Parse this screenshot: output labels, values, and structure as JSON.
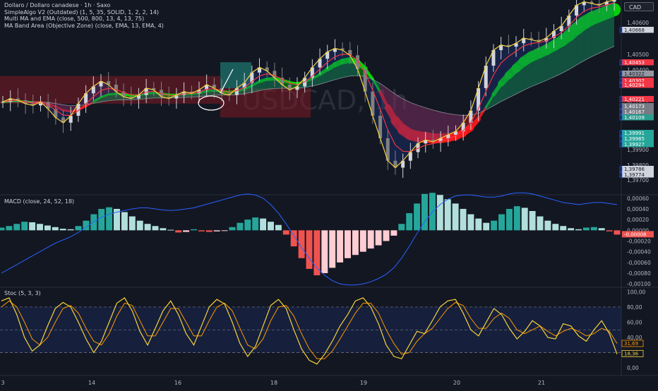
{
  "header": {
    "line1": "Dollaro / Dollaro canadese · 1h · Saxo",
    "line2": "SimpleAlgo V2 (Outdated) (1, 5, 35, SOLID, 1, 2, 2, 14)",
    "line3": "Multi MA and EMA (close, 500, 800, 13, 4, 13, 75)",
    "line4": "MA Band Area (Objective Zone) (close, EMA, 13, EMA, 4)",
    "currency": "CAD",
    "watermark": "USDCAD, 1h"
  },
  "colors": {
    "background": "#131722",
    "up": "#d1d4dc",
    "down": "#808080",
    "price_line": "#f7d23d",
    "ema_fast": "#f23645",
    "ma_slow": "#b2b5be",
    "band_green": "#00e600",
    "band_red": "#ff1a1a",
    "macd_pos_strong": "#26a69a",
    "macd_pos_weak": "#b2dfdb",
    "macd_neg_strong": "#ef5350",
    "macd_neg_weak": "#ffcdd2",
    "macd_line": "#2962ff",
    "stoch_k": "#f7d23d",
    "stoch_d": "#ff9800"
  },
  "price_axis": {
    "ticks": [
      "1,40600",
      "1,40500",
      "1,40400",
      "1,40200",
      "1,40000",
      "1,39900",
      "1,39800",
      "1,39700"
    ],
    "labels": [
      {
        "text": "1,40668",
        "bg": "#d1d4dc",
        "fg": "#131722"
      },
      {
        "text": "1,40453",
        "bg": "#f23645",
        "fg": "#ffffff"
      },
      {
        "text": "1,40322",
        "bg": "#9598a1",
        "fg": "#131722"
      },
      {
        "text": "1,40302",
        "bg": "#f23645",
        "fg": "#ffffff"
      },
      {
        "text": "1,40294",
        "bg": "#f23645",
        "fg": "#ffffff"
      },
      {
        "text": "1,40221",
        "bg": "#f23645",
        "fg": "#ffffff"
      },
      {
        "text": "1,40173",
        "bg": "#787b86",
        "fg": "#ffffff"
      },
      {
        "text": "1,40167",
        "bg": "#787b86",
        "fg": "#ffffff"
      },
      {
        "text": "1,40109",
        "bg": "#2a9d8f",
        "fg": "#ffffff"
      },
      {
        "text": "1,39991",
        "bg": "#26a69a",
        "fg": "#ffffff"
      },
      {
        "text": "1,39985",
        "bg": "#26a69a",
        "fg": "#ffffff"
      },
      {
        "text": "1,39927",
        "bg": "#26a69a",
        "fg": "#ffffff"
      },
      {
        "text": "1,39786",
        "bg": "#d1d4dc",
        "fg": "#131722"
      },
      {
        "text": "1,39774",
        "bg": "#d1d4dc",
        "fg": "#131722"
      }
    ]
  },
  "x_axis": {
    "labels": [
      "3",
      "14",
      "16",
      "18",
      "19",
      "20",
      "21"
    ]
  },
  "macd": {
    "title": "MACD (close, 24, 52, 18)",
    "ticks": [
      "0,00060",
      "0,00040",
      "0,00020",
      "0,00000",
      "-0,00020",
      "-0,00040",
      "-0,00060",
      "-0,00080",
      "-0,00100"
    ],
    "last_label": "-0,00008"
  },
  "stoch": {
    "title": "Stoc (5, 3, 3)",
    "ticks": [
      "100,00",
      "80,00",
      "60,00",
      "40,00",
      "20,00",
      "0,00"
    ],
    "last_d": "31,69",
    "last_k": "18,36"
  },
  "chart_data": [
    {
      "type": "line",
      "title": "Dollaro / Dollaro canadese · 1h · Saxo",
      "ylabel": "",
      "xlabel": "",
      "ylim": [
        1.3968,
        1.4075
      ],
      "x_tick_labels": [
        "3",
        "14",
        "16",
        "18",
        "19",
        "20",
        "21"
      ],
      "y_tick_labels": [
        "1,40600",
        "1,40500",
        "1,40400",
        "1,40200",
        "1,40000",
        "1,39900",
        "1,39800",
        "1,39700"
      ],
      "series": [
        {
          "values": [
            1.4016,
            1.4018,
            1.4017,
            1.4015,
            1.4014,
            1.4016,
            1.4012,
            1.4007,
            1.4004,
            1.4008,
            1.4015,
            1.4021,
            1.4025,
            1.4028,
            1.4026,
            1.4022,
            1.4019,
            1.4018,
            1.402,
            1.4024,
            1.4023,
            1.4019,
            1.4018,
            1.402,
            1.4022,
            1.4021,
            1.4023,
            1.4026,
            1.4024,
            1.4021,
            1.402,
            1.4024,
            1.4027,
            1.4033,
            1.4036,
            1.4034,
            1.403,
            1.4026,
            1.4023,
            1.4025,
            1.403,
            1.4036,
            1.4041,
            1.4045,
            1.4047,
            1.4046,
            1.4043,
            1.4035,
            1.4022,
            1.4008,
            1.3995,
            1.3982,
            1.3978,
            1.3982,
            1.3987,
            1.3992,
            1.3994,
            1.3993,
            1.3995,
            1.3997,
            1.3999,
            1.4004,
            1.4011,
            1.4024,
            1.4037,
            1.4046,
            1.4049,
            1.4048,
            1.405,
            1.4053,
            1.4052,
            1.4051,
            1.4053,
            1.4057,
            1.406,
            1.4066,
            1.4072,
            1.4074,
            1.4073,
            1.4072,
            1.4074,
            1.4075
          ]
        }
      ]
    },
    {
      "type": "bar",
      "title": "MACD (close, 24, 52, 18)",
      "ylim": [
        -0.00105,
        0.00065
      ],
      "series": [
        {
          "values": [
            5e-05,
            8e-05,
            0.00012,
            0.00016,
            0.00015,
            0.00012,
            9e-05,
            6e-05,
            3e-05,
            2e-05,
            8e-05,
            0.00018,
            0.0003,
            0.0004,
            0.00043,
            0.0004,
            0.00034,
            0.00026,
            0.00018,
            0.00012,
            8e-05,
            4e-05,
            1e-05,
            -4e-05,
            -3e-05,
            2e-05,
            -2e-05,
            -3e-05,
            -2e-05,
            -1e-05,
            6e-05,
            0.00014,
            0.0002,
            0.00024,
            0.00022,
            0.00016,
            0.0001,
            -8e-05,
            -0.0003,
            -0.00052,
            -0.00072,
            -0.00084,
            -0.0008,
            -0.0007,
            -0.0006,
            -0.00052,
            -0.00046,
            -0.0004,
            -0.00034,
            -0.00028,
            -0.0002,
            -0.0001,
            0.00012,
            0.00032,
            0.0005,
            0.00068,
            0.0007,
            0.00066,
            0.00058,
            0.0005,
            0.0004,
            0.0003,
            0.00022,
            0.00014,
            0.00018,
            0.0003,
            0.0004,
            0.00045,
            0.00042,
            0.00036,
            0.00026,
            0.00018,
            0.00012,
            8e-05,
            4e-05,
            2e-05,
            5e-05,
            6e-05,
            4e-05,
            -2e-05,
            -8e-05
          ]
        },
        {
          "values": [
            -0.0008,
            -0.00072,
            -0.00064,
            -0.00056,
            -0.00048,
            -0.0004,
            -0.00032,
            -0.00024,
            -0.00018,
            -0.00012,
            -4e-05,
            6e-05,
            0.00016,
            0.00024,
            0.0003,
            0.00034,
            0.00037,
            0.0004,
            0.00042,
            0.00042,
            0.0004,
            0.00038,
            0.00037,
            0.00038,
            0.0004,
            0.00042,
            0.00046,
            0.0005,
            0.00054,
            0.00058,
            0.00062,
            0.00066,
            0.00068,
            0.00066,
            0.0006,
            0.00048,
            0.00032,
            0.00012,
            -0.0001,
            -0.00032,
            -0.00052,
            -0.0007,
            -0.00084,
            -0.00094,
            -0.001,
            -0.00102,
            -0.00102,
            -0.001,
            -0.00096,
            -0.0009,
            -0.00082,
            -0.0007,
            -0.00052,
            -0.0003,
            -6e-05,
            0.00016,
            0.00034,
            0.00048,
            0.00058,
            0.00064,
            0.00066,
            0.00066,
            0.00064,
            0.00062,
            0.00062,
            0.00064,
            0.00068,
            0.0007,
            0.0007,
            0.00068,
            0.00064,
            0.0006,
            0.00056,
            0.00052,
            0.0005,
            0.00048,
            0.0005,
            0.00052,
            0.00052,
            0.0005,
            0.00048
          ]
        }
      ]
    },
    {
      "type": "line",
      "title": "Stoc (5, 3, 3)",
      "ylim": [
        -10,
        105
      ],
      "y_tick_labels": [
        "100,00",
        "80,00",
        "60,00",
        "40,00",
        "20,00",
        "0,00"
      ],
      "series": [
        {
          "values": [
            88,
            92,
            70,
            40,
            22,
            30,
            55,
            78,
            86,
            80,
            60,
            38,
            20,
            35,
            60,
            85,
            92,
            75,
            48,
            30,
            52,
            75,
            88,
            70,
            45,
            30,
            55,
            80,
            90,
            84,
            60,
            32,
            15,
            28,
            55,
            82,
            90,
            78,
            50,
            25,
            10,
            5,
            18,
            35,
            55,
            70,
            88,
            92,
            80,
            58,
            30,
            15,
            12,
            30,
            48,
            45,
            62,
            80,
            88,
            90,
            72,
            50,
            42,
            60,
            78,
            70,
            52,
            38,
            48,
            62,
            55,
            40,
            38,
            58,
            55,
            42,
            35,
            50,
            62,
            45,
            18
          ]
        },
        {
          "values": [
            80,
            88,
            80,
            60,
            38,
            30,
            40,
            60,
            78,
            82,
            72,
            52,
            35,
            30,
            45,
            68,
            85,
            82,
            62,
            42,
            42,
            60,
            78,
            78,
            60,
            42,
            42,
            62,
            80,
            85,
            75,
            52,
            30,
            25,
            38,
            62,
            80,
            82,
            68,
            45,
            25,
            12,
            12,
            22,
            38,
            55,
            72,
            85,
            85,
            72,
            50,
            32,
            18,
            20,
            35,
            45,
            52,
            65,
            78,
            86,
            82,
            65,
            52,
            52,
            65,
            72,
            65,
            50,
            45,
            50,
            55,
            48,
            42,
            48,
            52,
            48,
            42,
            45,
            52,
            48,
            32
          ]
        }
      ]
    }
  ]
}
